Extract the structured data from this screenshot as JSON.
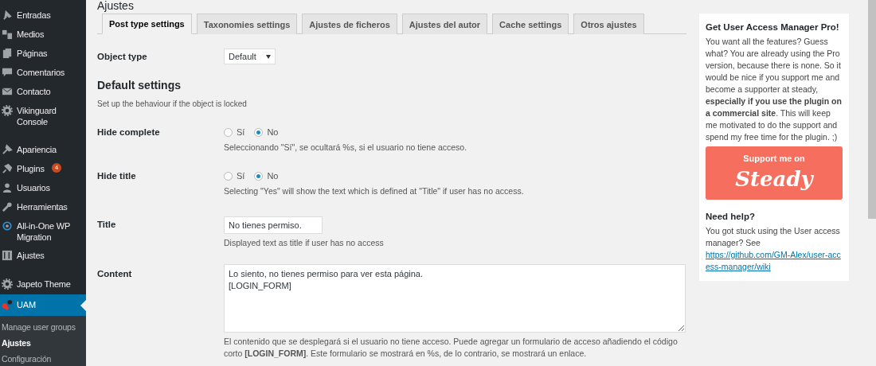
{
  "sidebar": {
    "groups": [
      [
        {
          "label": "Entradas",
          "selected": false
        },
        {
          "label": "Medios",
          "selected": false
        },
        {
          "label": "Páginas",
          "selected": false
        },
        {
          "label": "Comentarios",
          "selected": false
        },
        {
          "label": "Contacto",
          "selected": false
        },
        {
          "label": "Vikinguard Console",
          "selected": false
        }
      ],
      [
        {
          "label": "Apariencia",
          "selected": false
        },
        {
          "label": "Plugins",
          "badge": "4",
          "selected": false
        },
        {
          "label": "Usuarios",
          "selected": false
        },
        {
          "label": "Herramientas",
          "selected": false
        },
        {
          "label": "All-in-One WP Migration",
          "selected": false
        },
        {
          "label": "Ajustes",
          "selected": false
        }
      ],
      [
        {
          "label": "Japeto Theme",
          "selected": false
        },
        {
          "label": "UAM",
          "selected": true
        }
      ]
    ],
    "submenu": [
      {
        "label": "Manage user groups",
        "selected": false
      },
      {
        "label": "Ajustes",
        "selected": true
      },
      {
        "label": "Configuración",
        "selected": false
      }
    ]
  },
  "page_title": "Ajustes",
  "tabs": [
    {
      "label": "Post type settings",
      "selected": true
    },
    {
      "label": "Taxonomies settings",
      "selected": false
    },
    {
      "label": "Ajustes de ficheros",
      "selected": false
    },
    {
      "label": "Ajustes del autor",
      "selected": false
    },
    {
      "label": "Cache settings",
      "selected": false
    },
    {
      "label": "Otros ajustes",
      "selected": false
    }
  ],
  "object_type": {
    "label": "Object type",
    "value": "Default"
  },
  "section": {
    "title": "Default settings",
    "description": "Set up the behaviour if the object is locked"
  },
  "rows": [
    {
      "kind": "radio",
      "label": "Hide complete",
      "options": [
        {
          "label": "Sí",
          "selected": false
        },
        {
          "label": "No",
          "selected": true
        }
      ],
      "help": "Seleccionando \"Sí\", se ocultará %s, si el usuario no tiene acceso."
    },
    {
      "kind": "radio",
      "label": "Hide title",
      "options": [
        {
          "label": "Sí",
          "selected": false
        },
        {
          "label": "No",
          "selected": true
        }
      ],
      "help": "Selecting \"Yes\" will show the text which is defined at \"Title\" if user has no access."
    },
    {
      "kind": "text",
      "label": "Title",
      "value": "No tienes permiso.",
      "help": "Displayed text as title if user has no access"
    },
    {
      "kind": "textarea",
      "label": "Content",
      "value": "Lo siento, no tienes permiso para ver esta página.\n[LOGIN_FORM]",
      "help": "El contenido que se desplegará si el usuario no tiene acceso. Puede agregar un formulario de acceso añadiendo el código corto **[LOGIN_FORM]**. Este formulario se mostrará en %s, de lo contrario, se mostrará un enlace."
    }
  ],
  "promo": {
    "title": "Get User Access Manager Pro!",
    "text": "You want all the features? Guess what? You are already using the Pro version, because there is none. So it would be nice if you support me and become a supporter at steady, **especially if you use the plugin on a commercial site**. This will keep me motivated to do the support and spend my free time for the plugin. ;)",
    "button_top": "Support me on",
    "button_brand": "Steady",
    "help_title": "Need help?",
    "help_text": "You got stuck using the User access manager? See ",
    "help_link": "https://github.com/GM-Alex/user-access-manager/wiki"
  }
}
